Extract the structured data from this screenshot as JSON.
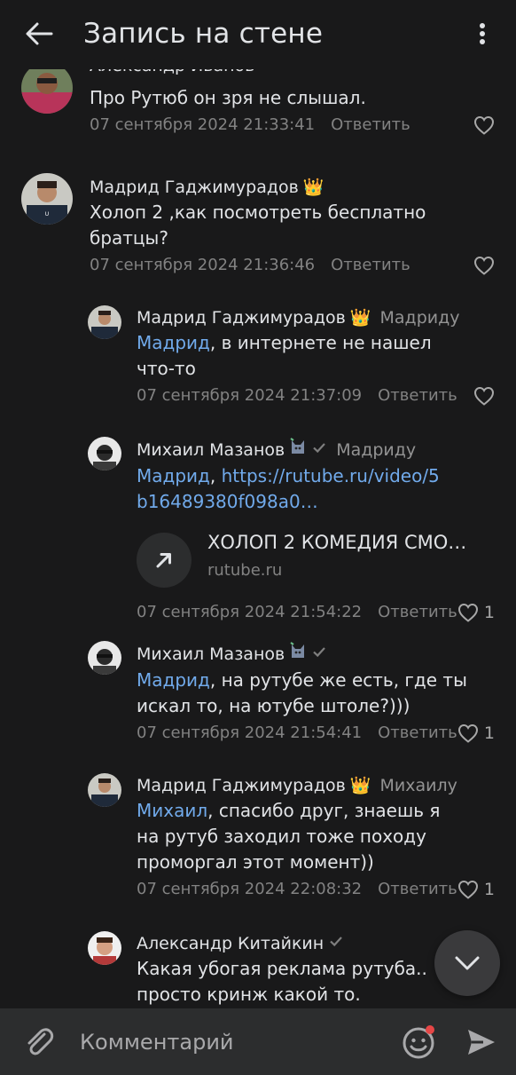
{
  "header": {
    "title": "Запись на стене"
  },
  "comments": [
    {
      "author": "Александр Иванов",
      "text": "Про Рутюб он зря не слышал.",
      "date": "07 сентября 2024 21:33:41",
      "reply_label": "Ответить",
      "likes": ""
    },
    {
      "author": "Мадрид Гаджимурадов",
      "badge_emoji": "👑",
      "text": "Холоп 2 ,как посмотреть бесплатно братцы?",
      "date": "07 сентября 2024 21:36:46",
      "reply_label": "Ответить",
      "likes": ""
    },
    {
      "author": "Мадрид Гаджимурадов",
      "badge_emoji": "👑",
      "reply_to": "Мадриду",
      "mention": "Мадрид",
      "text": ", в интернете не нашел что-то",
      "date": "07 сентября 2024 21:37:09",
      "reply_label": "Ответить",
      "likes": ""
    },
    {
      "author": "Михаил Мазанов",
      "reply_to": "Мадриду",
      "mention": "Мадрид",
      "sep": ", ",
      "link_text": "https://rutube.ru/video/5b16489380f098a0…",
      "attachment": {
        "title": "ХОЛОП 2 КОМЕДИЯ СМО…",
        "domain": "rutube.ru"
      },
      "date": "07 сентября 2024 21:54:22",
      "reply_label": "Ответить",
      "likes": "1"
    },
    {
      "author": "Михаил Мазанов",
      "mention": "Мадрид",
      "text": ", на рутубе же есть, где ты искал то, на ютубе штоле?)))",
      "date": "07 сентября 2024 21:54:41",
      "reply_label": "Ответить",
      "likes": "1"
    },
    {
      "author": "Мадрид Гаджимурадов",
      "badge_emoji": "👑",
      "reply_to": "Михаилу",
      "mention": "Михаил",
      "text": ", спасибо друг, знаешь я на рутуб заходил тоже походу проморгал этот момент))",
      "date": "07 сентября 2024 22:08:32",
      "reply_label": "Ответить",
      "likes": "1"
    },
    {
      "author": "Александр Китайкин",
      "text": "Какая убогая реклама рутуба.. просто кринж какой то."
    }
  ],
  "composer": {
    "placeholder": "Комментарий"
  },
  "colors": {
    "background": "#19191a",
    "link": "#71aaeb",
    "secondary": "#828282",
    "composer": "#2c2d2e"
  },
  "icons": [
    "back-arrow-icon",
    "more-vertical-icon",
    "heart-icon",
    "verified-check-icon",
    "link-arrow-icon",
    "chevron-down-icon",
    "paperclip-icon",
    "emoji-icon",
    "send-icon"
  ]
}
